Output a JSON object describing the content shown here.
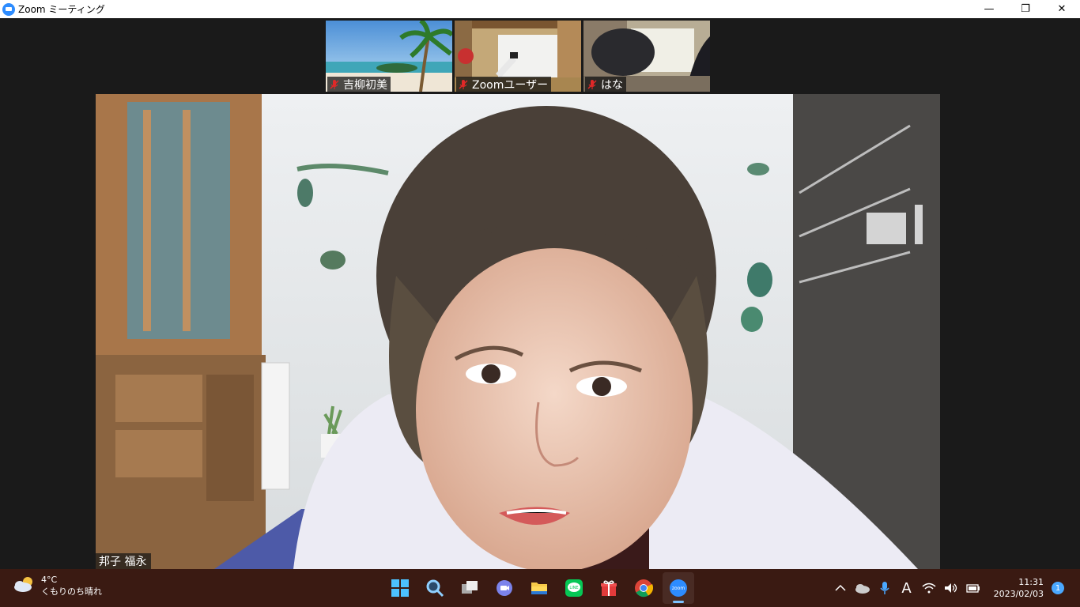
{
  "window": {
    "title": "Zoom ミーティング",
    "minimize_glyph": "—",
    "maximize_glyph": "❐",
    "close_glyph": "✕"
  },
  "participants": [
    {
      "name": "吉柳初美",
      "muted": true
    },
    {
      "name": "Zoomユーザー",
      "muted": true
    },
    {
      "name": "はな",
      "muted": true
    }
  ],
  "speaker": {
    "name": "邦子 福永"
  },
  "taskbar": {
    "weather": {
      "temp": "4°C",
      "condition": "くもりのち晴れ"
    },
    "apps": [
      "start-icon",
      "search-icon",
      "task-view-icon",
      "teams-chat-icon",
      "file-explorer-icon",
      "line-icon",
      "gift-icon",
      "chrome-icon",
      "zoom-icon"
    ],
    "active_app": "zoom-icon",
    "tray": {
      "ime": "A"
    },
    "clock": {
      "time": "11:31",
      "date": "2023/02/03"
    },
    "notifications": "1"
  },
  "colors": {
    "zoom_blue": "#2d8cff",
    "taskbar_bg": "#3a1a12",
    "meeting_bg": "#1a1a1a",
    "muted_red": "#e02828"
  }
}
